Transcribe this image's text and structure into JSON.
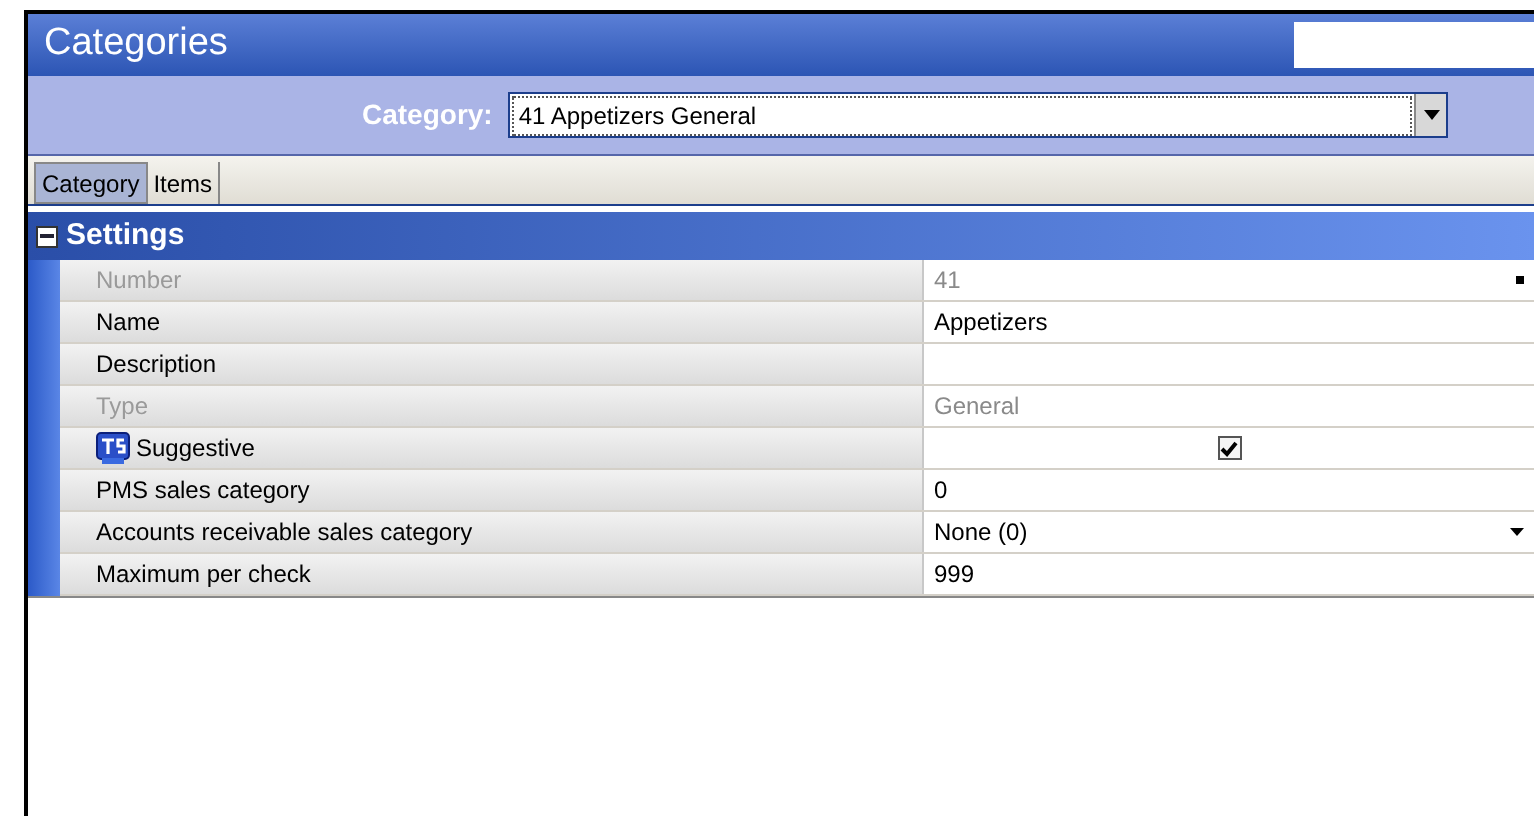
{
  "window": {
    "title": "Categories"
  },
  "category_selector": {
    "label": "Category:",
    "value": "41 Appetizers General"
  },
  "tabs": [
    {
      "label": "Category",
      "selected": true
    },
    {
      "label": "Items",
      "selected": false
    }
  ],
  "section": {
    "title": "Settings",
    "expanded": true
  },
  "rows": [
    {
      "label": "Number",
      "kind": "text",
      "value": "41",
      "disabled": true,
      "has_button": true
    },
    {
      "label": "Name",
      "kind": "text",
      "value": "Appetizers",
      "disabled": false
    },
    {
      "label": "Description",
      "kind": "text",
      "value": "",
      "disabled": false
    },
    {
      "label": "Type",
      "kind": "text",
      "value": "General",
      "disabled": true
    },
    {
      "label": "Suggestive",
      "kind": "checkbox",
      "checked": true,
      "disabled": false,
      "badge": true
    },
    {
      "label": "PMS sales category",
      "kind": "text",
      "value": "0",
      "disabled": false
    },
    {
      "label": "Accounts receivable sales category",
      "kind": "dropdown",
      "value": "None (0)",
      "disabled": false
    },
    {
      "label": "Maximum per check",
      "kind": "text",
      "value": "999",
      "disabled": false
    }
  ]
}
